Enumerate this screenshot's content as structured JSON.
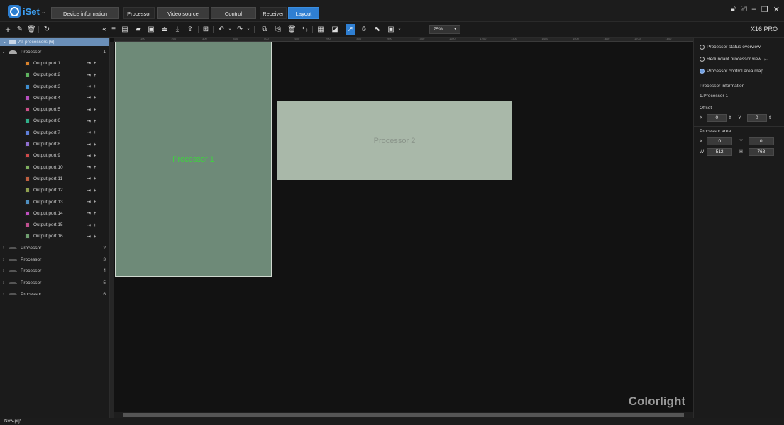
{
  "app": {
    "name": "iSet",
    "model": "X16 PRO",
    "brand_watermark": "Colorlight",
    "project_file": "New.prj*"
  },
  "tabs": [
    {
      "label": "Device information",
      "active": false
    },
    {
      "label": "Processor",
      "active": false,
      "group": true
    },
    {
      "label": "Video source",
      "active": false
    },
    {
      "label": "Control",
      "active": false
    },
    {
      "label": "Receiver",
      "active": false,
      "group": true
    },
    {
      "label": "Layout",
      "active": true
    }
  ],
  "toolbar": {
    "zoom": "75%"
  },
  "tree": {
    "header": "All processors (6)",
    "expanded_processor": {
      "label": "Processor",
      "number": "1"
    },
    "ports": [
      {
        "label": "Output port 1",
        "color": "#d9822b"
      },
      {
        "label": "Output port 2",
        "color": "#5fb35f"
      },
      {
        "label": "Output port 3",
        "color": "#3e8ed0"
      },
      {
        "label": "Output port 4",
        "color": "#b84fc0"
      },
      {
        "label": "Output port 5",
        "color": "#d04f8a"
      },
      {
        "label": "Output port 6",
        "color": "#2fb08a"
      },
      {
        "label": "Output port 7",
        "color": "#5f7fd8"
      },
      {
        "label": "Output port 8",
        "color": "#8f6fd0"
      },
      {
        "label": "Output port 9",
        "color": "#d04a4a"
      },
      {
        "label": "Output port 10",
        "color": "#7fb05f"
      },
      {
        "label": "Output port 11",
        "color": "#c05f3f"
      },
      {
        "label": "Output port 12",
        "color": "#8fa04f"
      },
      {
        "label": "Output port 13",
        "color": "#4f8fc0"
      },
      {
        "label": "Output port 14",
        "color": "#c04fc0"
      },
      {
        "label": "Output port 15",
        "color": "#c04f8f"
      },
      {
        "label": "Output port 16",
        "color": "#6f9f6f"
      }
    ],
    "collapsed": [
      {
        "label": "Processor",
        "number": "2"
      },
      {
        "label": "Processor",
        "number": "3"
      },
      {
        "label": "Processor",
        "number": "4"
      },
      {
        "label": "Processor",
        "number": "5"
      },
      {
        "label": "Processor",
        "number": "6"
      }
    ]
  },
  "canvas": {
    "rulers": [
      "100",
      "200",
      "300",
      "400",
      "500",
      "600",
      "700",
      "800",
      "900",
      "1000",
      "1100",
      "1200",
      "1300",
      "1400",
      "1500",
      "1600",
      "1700",
      "1800"
    ],
    "regions": [
      {
        "label": "Processor 1",
        "fill": "#6e8a78",
        "text_color": "#3fd23f"
      },
      {
        "label": "Processor 2",
        "fill": "#a9b8a9",
        "text_color": "#8a948a"
      }
    ]
  },
  "right": {
    "views": [
      {
        "label": "Processor status overview",
        "selected": false
      },
      {
        "label": "Redundant processor view",
        "selected": false
      },
      {
        "label": "Processor control area map",
        "selected": true
      }
    ],
    "info_title": "Processor information",
    "info_value": "1.Processor 1",
    "offset_title": "Offset",
    "offset": {
      "x_label": "X",
      "x": "0",
      "y_label": "Y",
      "y": "0"
    },
    "area_title": "Processor area",
    "area": {
      "x_label": "X",
      "x": "0",
      "y_label": "Y",
      "y": "0",
      "w_label": "W",
      "w": "512",
      "h_label": "H",
      "h": "768"
    }
  }
}
